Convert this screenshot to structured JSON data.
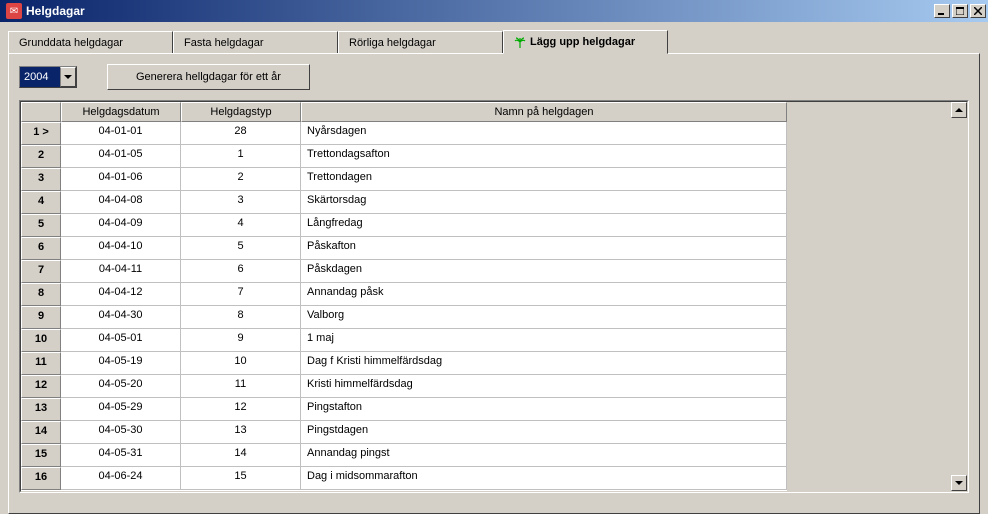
{
  "window": {
    "title": "Helgdagar"
  },
  "tabs": [
    {
      "label": "Grunddata helgdagar",
      "active": false
    },
    {
      "label": "Fasta helgdagar",
      "active": false
    },
    {
      "label": "Rörliga helgdagar",
      "active": false
    },
    {
      "label": "Lägg upp helgdagar",
      "active": true
    }
  ],
  "toolbar": {
    "year_value": "2004",
    "generate_label": "Generera hellgdagar för ett år"
  },
  "grid": {
    "headers": {
      "rownum": "",
      "date": "Helgdagsdatum",
      "type": "Helgdagstyp",
      "name": "Namn på helgdagen"
    },
    "rows": [
      {
        "num": "1 >",
        "date": "04-01-01",
        "type": "28",
        "name": "Nyårsdagen"
      },
      {
        "num": "2",
        "date": "04-01-05",
        "type": "1",
        "name": "Trettondagsafton"
      },
      {
        "num": "3",
        "date": "04-01-06",
        "type": "2",
        "name": "Trettondagen"
      },
      {
        "num": "4",
        "date": "04-04-08",
        "type": "3",
        "name": "Skärtorsdag"
      },
      {
        "num": "5",
        "date": "04-04-09",
        "type": "4",
        "name": "Långfredag"
      },
      {
        "num": "6",
        "date": "04-04-10",
        "type": "5",
        "name": "Påskafton"
      },
      {
        "num": "7",
        "date": "04-04-11",
        "type": "6",
        "name": "Påskdagen"
      },
      {
        "num": "8",
        "date": "04-04-12",
        "type": "7",
        "name": "Annandag påsk"
      },
      {
        "num": "9",
        "date": "04-04-30",
        "type": "8",
        "name": "Valborg"
      },
      {
        "num": "10",
        "date": "04-05-01",
        "type": "9",
        "name": "1 maj"
      },
      {
        "num": "11",
        "date": "04-05-19",
        "type": "10",
        "name": "Dag f Kristi himmelfärdsdag"
      },
      {
        "num": "12",
        "date": "04-05-20",
        "type": "11",
        "name": "Kristi himmelfärdsdag"
      },
      {
        "num": "13",
        "date": "04-05-29",
        "type": "12",
        "name": "Pingstafton"
      },
      {
        "num": "14",
        "date": "04-05-30",
        "type": "13",
        "name": "Pingstdagen"
      },
      {
        "num": "15",
        "date": "04-05-31",
        "type": "14",
        "name": "Annandag pingst"
      },
      {
        "num": "16",
        "date": "04-06-24",
        "type": "15",
        "name": "Dag i midsommarafton"
      }
    ]
  }
}
